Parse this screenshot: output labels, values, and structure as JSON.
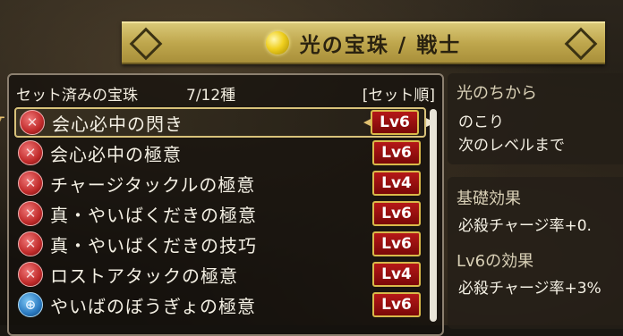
{
  "banner": {
    "title": "光の宝珠 / 戦士",
    "icon": "light-orb-icon"
  },
  "list_panel": {
    "title": "セット済みの宝珠",
    "count": "7/12種",
    "sort_label": "[セット順]",
    "items": [
      {
        "name": "会心必中の閃き",
        "level": "Lv6",
        "gem": "red"
      },
      {
        "name": "会心必中の極意",
        "level": "Lv6",
        "gem": "red"
      },
      {
        "name": "チャージタックルの極意",
        "level": "Lv4",
        "gem": "red"
      },
      {
        "name": "真・やいばくだきの極意",
        "level": "Lv6",
        "gem": "red"
      },
      {
        "name": "真・やいばくだきの技巧",
        "level": "Lv6",
        "gem": "red"
      },
      {
        "name": "ロストアタックの極意",
        "level": "Lv4",
        "gem": "red"
      },
      {
        "name": "やいばのぼうぎょの極意",
        "level": "Lv6",
        "gem": "blue"
      }
    ]
  },
  "power_panel": {
    "title": "光のちから",
    "remaining_label": "のこり",
    "next_level_label": "次のレベルまで"
  },
  "effect_panel": {
    "base_title": "基礎効果",
    "base_text": "必殺チャージ率+0.",
    "lv_title": "Lv6の効果",
    "lv_text": "必殺チャージ率+3%"
  },
  "colors": {
    "level_badge": "#9b1010",
    "badge_border": "#d9b94a",
    "banner": "#c7b35a"
  }
}
